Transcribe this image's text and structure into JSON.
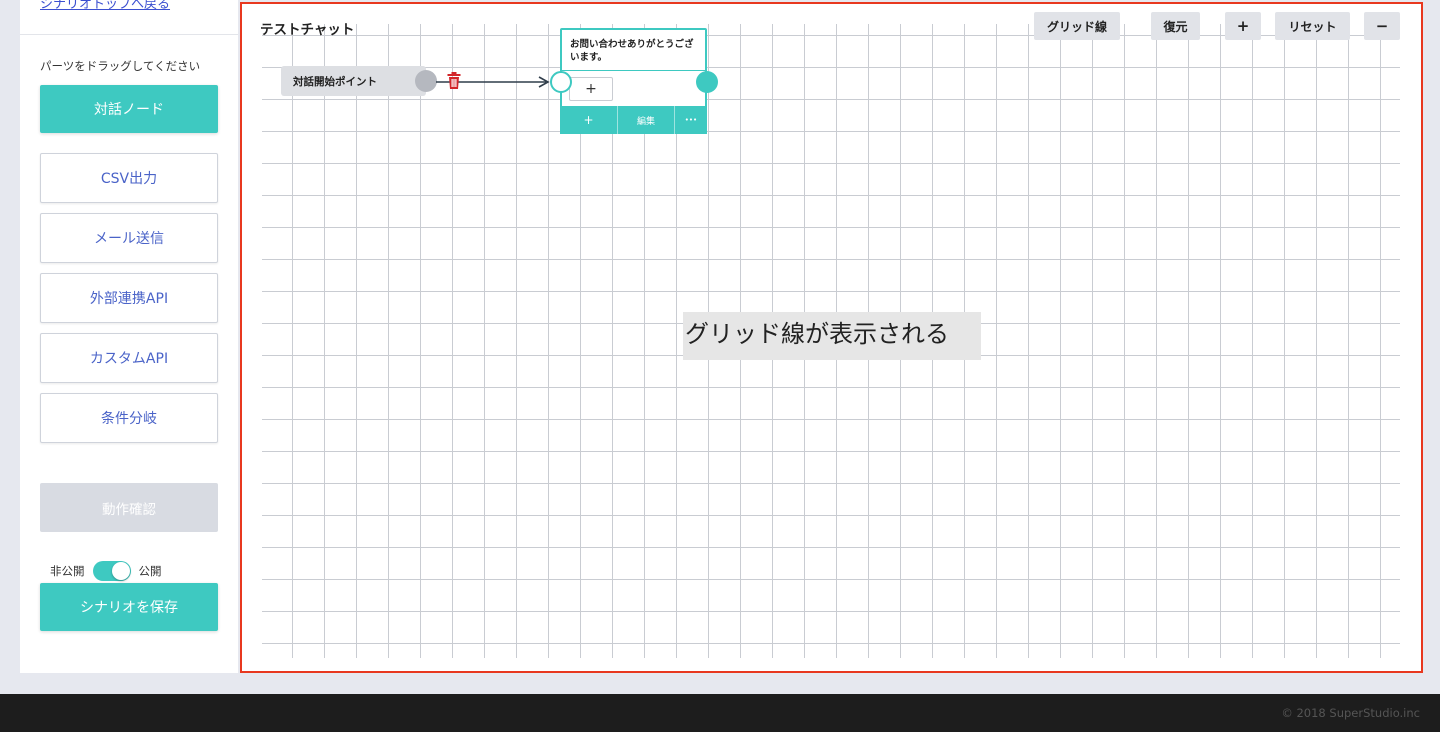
{
  "sidebar": {
    "back_link": "シナリオトップへ戻る",
    "hint": "パーツをドラッグしてください",
    "parts": {
      "dialog_node": "対話ノード",
      "csv": "CSV出力",
      "mail": "メール送信",
      "external_api": "外部連携API",
      "custom_api": "カスタムAPI",
      "condition": "条件分岐"
    },
    "verify": "動作確認",
    "toggle": {
      "private": "非公開",
      "public": "公開",
      "state": "公開"
    },
    "save": "シナリオを保存"
  },
  "editor": {
    "title": "テストチャット",
    "toolbar": {
      "grid": "グリッド線",
      "restore": "復元",
      "zoom_in": "+",
      "reset": "リセット",
      "zoom_out": "−"
    },
    "start_node": {
      "label": "対話開始ポイント"
    },
    "dialog_node": {
      "text": "お問い合わせありがとうございます。",
      "inner_add": "+",
      "footer_add": "+",
      "edit": "編集",
      "more": "•••"
    },
    "caption": "グリッド線が表示される"
  },
  "footer": {
    "copyright": "© 2018 SuperStudio.inc"
  },
  "colors": {
    "accent": "#3ec9c1",
    "highlight_border": "#e8381f",
    "link": "#3b4fd0"
  },
  "icons": [
    "trash-icon",
    "arrow-connector"
  ]
}
